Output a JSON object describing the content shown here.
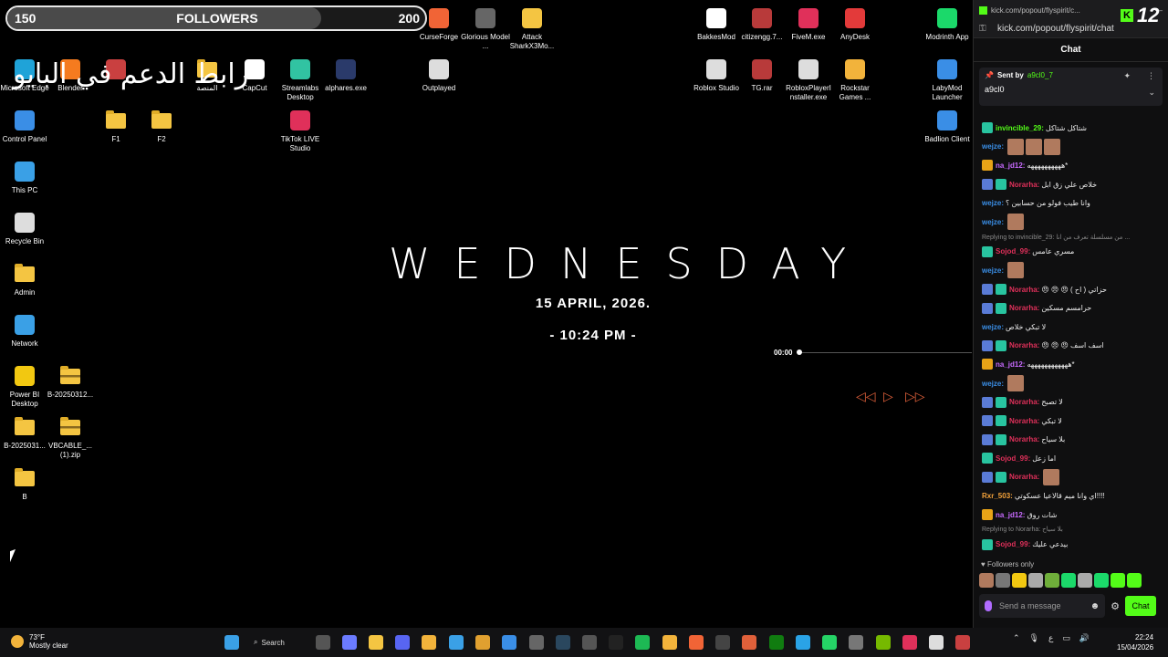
{
  "followers_bar": {
    "current": "150",
    "label": "FOLLOWERS",
    "goal": "200",
    "progress": 0.75
  },
  "arabic_banner": "رابط الدعم في البايو",
  "desktop_icons": [
    {
      "label": "CurseForge",
      "icon": "curseforge-icon",
      "color": "#f16436"
    },
    {
      "label": "Glorious Model ...",
      "icon": "glorious-icon",
      "color": "#666"
    },
    {
      "label": "Attack SharkX3Mo...",
      "icon": "attack-shark-icon",
      "color": "#f4c542"
    },
    {
      "label": "BakkesMod",
      "icon": "bakkesmod-icon",
      "color": "#fff"
    },
    {
      "label": "citizengg.7...",
      "icon": "winrar-icon",
      "color": "#b83a3a"
    },
    {
      "label": "FiveM.exe",
      "icon": "fivem-icon",
      "color": "#e0305a"
    },
    {
      "label": "AnyDesk",
      "icon": "anydesk-icon",
      "color": "#e33a3a"
    },
    {
      "label": "Modrinth App",
      "icon": "modrinth-icon",
      "color": "#1bd96a"
    },
    {
      "label": "Microsoft Edge",
      "icon": "edge-icon",
      "color": "#1fa3d8"
    },
    {
      "label": "Blender",
      "icon": "blender-icon",
      "color": "#f57b1f"
    },
    {
      "label": "",
      "icon": "app-icon",
      "color": "#c94040"
    },
    {
      "label": "المنصة",
      "icon": "folder-icon",
      "color": "#f4c542"
    },
    {
      "label": "CapCut",
      "icon": "capcut-icon",
      "color": "#fff"
    },
    {
      "label": "Streamlabs Desktop",
      "icon": "streamlabs-icon",
      "color": "#31c3a2"
    },
    {
      "label": "alphares.exe",
      "icon": "alphares-icon",
      "color": "#2a3a6a"
    },
    {
      "label": "Outplayed",
      "icon": "outplayed-icon",
      "color": "#ddd"
    },
    {
      "label": "Roblox Studio",
      "icon": "roblox-studio-icon",
      "color": "#ddd"
    },
    {
      "label": "TG.rar",
      "icon": "winrar-icon",
      "color": "#b83a3a"
    },
    {
      "label": "RobloxPlayerI nstaller.exe",
      "icon": "roblox-icon",
      "color": "#ddd"
    },
    {
      "label": "Rockstar Games ...",
      "icon": "rockstar-icon",
      "color": "#f2b33b"
    },
    {
      "label": "LabyMod Launcher",
      "icon": "labymod-icon",
      "color": "#3a8ee6"
    },
    {
      "label": "Control Panel",
      "icon": "control-panel-icon",
      "color": "#3a8ee6"
    },
    {
      "label": "F1",
      "icon": "folder-icon",
      "color": "#f4c542"
    },
    {
      "label": "F2",
      "icon": "folder-icon",
      "color": "#f4c542"
    },
    {
      "label": "TikTok LIVE Studio",
      "icon": "tiktok-icon",
      "color": "#e0305a"
    },
    {
      "label": "Badlion Client",
      "icon": "badlion-icon",
      "color": "#3a8ee6"
    },
    {
      "label": "This PC",
      "icon": "this-pc-icon",
      "color": "#3aa0e6"
    },
    {
      "label": "Recycle Bin",
      "icon": "recycle-bin-icon",
      "color": "#ddd"
    },
    {
      "label": "Admin",
      "icon": "folder-icon",
      "color": "#f4c542"
    },
    {
      "label": "Network",
      "icon": "network-icon",
      "color": "#3aa0e6"
    },
    {
      "label": "Power BI Desktop",
      "icon": "power-bi-icon",
      "color": "#f2c811"
    },
    {
      "label": "B-20250312...",
      "icon": "zip-folder-icon",
      "color": "#f4c542"
    },
    {
      "label": "B-2025031...",
      "icon": "folder-icon",
      "color": "#f4c542"
    },
    {
      "label": "VBCABLE_... (1).zip",
      "icon": "zip-folder-icon",
      "color": "#f4c542"
    },
    {
      "label": "B",
      "icon": "folder-icon",
      "color": "#f4c542"
    }
  ],
  "clock_widget": {
    "day": "WEDNESDAY",
    "date": "15  APRIL, 2026.",
    "time": "- 10:24 PM -"
  },
  "media": {
    "elapsed": "00:00",
    "accent": "#e0603a",
    "prev_icon": "rewind-icon",
    "play_icon": "play-icon",
    "next_icon": "fast-forward-icon"
  },
  "browser": {
    "tab_url": "kick.com/popout/flyspirit/c...",
    "url": "kick.com/popout/flyspirit/chat",
    "kick_number": "12"
  },
  "chat": {
    "title": "Chat",
    "pinned": {
      "sent_by_label": "Sent by",
      "sender": "a9cl0_7",
      "message": "a9cl0"
    },
    "messages": [
      {
        "badges": [
          "sub"
        ],
        "user": "invincible_29:",
        "color": "#53fc18",
        "text": "شتاكل شتاكل",
        "emotes": 0
      },
      {
        "badges": [],
        "user": "wejze:",
        "color": "#3a8ee6",
        "text": "",
        "emotes": 3
      },
      {
        "badges": [
          "crown"
        ],
        "user": "na_jd12:",
        "color": "#c86aff",
        "text": "*ههههههههههه",
        "emotes": 0
      },
      {
        "badges": [
          "mod",
          "sub"
        ],
        "user": "Norarha:",
        "color": "#e0305a",
        "text": "خلاص علي زق ابل",
        "emotes": 0
      },
      {
        "badges": [],
        "user": "wejze:",
        "color": "#3a8ee6",
        "text": "وانا طيب فولو من حسابين ؟",
        "emotes": 0
      },
      {
        "badges": [],
        "user": "wejze:",
        "color": "#3a8ee6",
        "text": "",
        "emotes": 1
      },
      {
        "reply": "Replying to invincible_29: من مسلسلة تعرف من انا ..."
      },
      {
        "badges": [
          "sub"
        ],
        "user": "Sojod_99:",
        "color": "#e0305a",
        "text": "مسري عامس",
        "emotes": 0
      },
      {
        "badges": [],
        "user": "wejze:",
        "color": "#3a8ee6",
        "text": "",
        "emotes": 1
      },
      {
        "badges": [
          "mod",
          "sub"
        ],
        "user": "Norarha:",
        "color": "#e0305a",
        "text": "حزاتي ( اح ) 😠 😠 😠",
        "emotes": 0
      },
      {
        "badges": [
          "mod",
          "sub"
        ],
        "user": "Norarha:",
        "color": "#e0305a",
        "text": "حرامسم مسكين",
        "emotes": 0
      },
      {
        "badges": [],
        "user": "wejze:",
        "color": "#3a8ee6",
        "text": "لا تبكي خلاص",
        "emotes": 0
      },
      {
        "badges": [
          "mod",
          "sub"
        ],
        "user": "Norarha:",
        "color": "#e0305a",
        "text": "اسف اسف 😠 😠 😠",
        "emotes": 0
      },
      {
        "badges": [
          "crown"
        ],
        "user": "na_jd12:",
        "color": "#c86aff",
        "text": "*ههههههههههههه",
        "emotes": 0
      },
      {
        "badges": [],
        "user": "wejze:",
        "color": "#3a8ee6",
        "text": "",
        "emotes": 1
      },
      {
        "badges": [
          "mod",
          "sub"
        ],
        "user": "Norarha:",
        "color": "#e0305a",
        "text": "لا تصبح",
        "emotes": 0
      },
      {
        "badges": [
          "mod",
          "sub"
        ],
        "user": "Norarha:",
        "color": "#e0305a",
        "text": "لا تبكي",
        "emotes": 0
      },
      {
        "badges": [
          "mod",
          "sub"
        ],
        "user": "Norarha:",
        "color": "#e0305a",
        "text": "بلا سياح",
        "emotes": 0
      },
      {
        "badges": [
          "sub"
        ],
        "user": "Sojod_99:",
        "color": "#e0305a",
        "text": "اما زعل",
        "emotes": 0
      },
      {
        "badges": [
          "mod",
          "sub"
        ],
        "user": "Norarha:",
        "color": "#e0305a",
        "text": "",
        "emotes": 1
      },
      {
        "badges": [],
        "user": "Rxr_503:",
        "color": "#f4a23a",
        "text": "!!!!اي وانا ميم قالاعيا عسكوتي",
        "emotes": 0
      },
      {
        "badges": [
          "crown"
        ],
        "user": "na_jd12:",
        "color": "#c86aff",
        "text": "شات روق",
        "emotes": 0
      },
      {
        "reply": "Replying to Norarha: بلا سياح"
      },
      {
        "badges": [
          "sub"
        ],
        "user": "Sojod_99:",
        "color": "#e0305a",
        "text": "بيدعي عليك",
        "emotes": 0
      }
    ],
    "followers_only": "Followers only",
    "input_placeholder": "Send a message",
    "send_label": "Chat",
    "emote_colors": [
      "#b07a5e",
      "#777",
      "#f2c811",
      "#aaa",
      "#6fae3a",
      "#1bd96a",
      "#aaa",
      "#1bd96a",
      "#53fc18",
      "#53fc18"
    ]
  },
  "taskbar": {
    "weather_temp": "73°F",
    "weather_desc": "Mostly clear",
    "search_label": "Search",
    "lang": "ع",
    "time": "22:24",
    "date": "15/04/2026",
    "apps": [
      {
        "icon": "start-icon",
        "color": "#3aa0e6"
      },
      {
        "icon": "task-view-icon",
        "color": "#555"
      },
      {
        "icon": "copilot-icon",
        "color": "#6b7bff"
      },
      {
        "icon": "file-explorer-icon",
        "color": "#f4c542"
      },
      {
        "icon": "discord-icon",
        "color": "#5865f2"
      },
      {
        "icon": "app-icon",
        "color": "#f2b33b"
      },
      {
        "icon": "chrome-icon",
        "color": "#3aa0e6"
      },
      {
        "icon": "chrome-icon",
        "color": "#e0a030"
      },
      {
        "icon": "mail-icon",
        "color": "#3a8ee6"
      },
      {
        "icon": "cube-icon",
        "color": "#666"
      },
      {
        "icon": "steam-icon",
        "color": "#2a475e"
      },
      {
        "icon": "capture-icon",
        "color": "#555"
      },
      {
        "icon": "app-icon",
        "color": "#222"
      },
      {
        "icon": "spotify-icon",
        "color": "#1db954"
      },
      {
        "icon": "rockstar-icon",
        "color": "#f2b33b"
      },
      {
        "icon": "curseforge-icon",
        "color": "#f16436"
      },
      {
        "icon": "obs-icon",
        "color": "#444"
      },
      {
        "icon": "app-icon",
        "color": "#e0603a"
      },
      {
        "icon": "xbox-icon",
        "color": "#107c10"
      },
      {
        "icon": "telegram-icon",
        "color": "#2aa3e6"
      },
      {
        "icon": "whatsapp-icon",
        "color": "#25d366"
      },
      {
        "icon": "settings-icon",
        "color": "#777"
      },
      {
        "icon": "nvidia-icon",
        "color": "#76b900"
      },
      {
        "icon": "app-icon",
        "color": "#e0305a"
      },
      {
        "icon": "gear-icon",
        "color": "#ddd"
      },
      {
        "icon": "app-icon",
        "color": "#c94040"
      }
    ]
  }
}
